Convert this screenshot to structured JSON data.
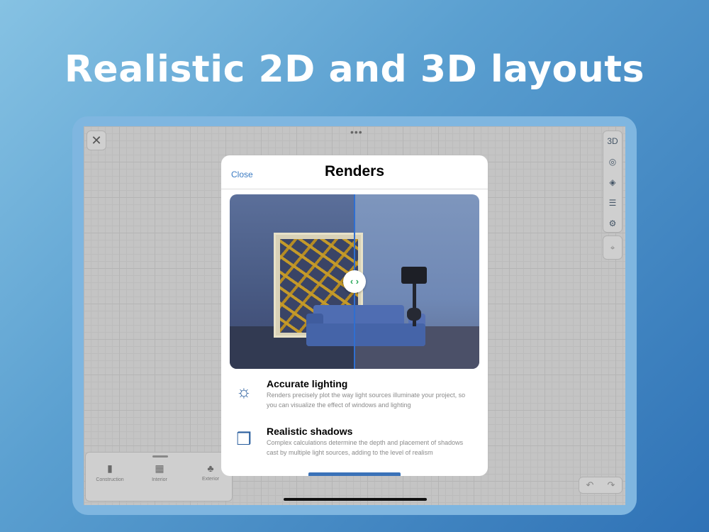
{
  "headline": "Realistic 2D and 3D layouts",
  "toolbar": {
    "dots": "•••",
    "close_icon": "✕",
    "right_buttons": [
      "3D",
      "◎",
      "◈",
      "☰",
      "⚙"
    ],
    "right_icons": [
      "3d-view-icon",
      "camera-icon",
      "layers-icon",
      "list-icon",
      "settings-icon"
    ],
    "focus_icon": "⌖",
    "undo": "↶",
    "redo": "↷"
  },
  "bottom_panel": {
    "items": [
      {
        "label": "Construction",
        "icon": "▮"
      },
      {
        "label": "Interior",
        "icon": "▦"
      },
      {
        "label": "Exterior",
        "icon": "♣"
      }
    ]
  },
  "modal": {
    "close_label": "Close",
    "title": "Renders",
    "split_handle": "‹ ›",
    "features": [
      {
        "title": "Accurate lighting",
        "description": "Renders precisely plot the way light sources illuminate your project, so you can visualize the effect of windows and lighting",
        "icon": "☼"
      },
      {
        "title": "Realistic shadows",
        "description": "Complex calculations determine the depth and placement of shadows cast by multiple light sources, adding to the level of realism",
        "icon": "❒"
      }
    ]
  },
  "colors": {
    "accent": "#3a7ac2",
    "background_start": "#86c2e3",
    "background_end": "#2f72b6",
    "device_frame": "#7fb6e0"
  }
}
